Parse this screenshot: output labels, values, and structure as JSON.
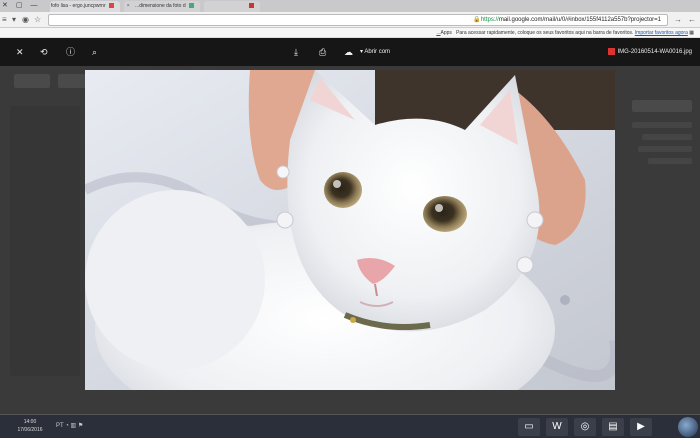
{
  "browser": {
    "tabs": [
      {
        "label": "fofo lisa - ergo.juncpwrnr"
      },
      {
        "label": "dimensione da foto d..."
      },
      {
        "label": ""
      }
    ],
    "window_controls": [
      "✕",
      "▢",
      "—"
    ],
    "url_scheme": "https://",
    "url_rest": "mail.google.com/mail/u/0/#inbox/155f4112a557b?projector=1",
    "bookmarks_text": "Para acessar rapidamente, coloque os seus favoritos aqui na barra de favoritos.",
    "bookmarks_link": "Importar favoritos agora...",
    "apps_label": "Apps"
  },
  "viewer": {
    "filename": "IMG-20160514-WA0016.jpg",
    "open_with": "Abrir com",
    "icons": [
      "close-icon",
      "back-icon",
      "info-icon",
      "zoom-icon",
      "download-icon",
      "print-icon",
      "drive-icon"
    ]
  },
  "taskbar": {
    "time": "14:00",
    "date": "17/06/2016",
    "tray_text": "PT"
  },
  "colors": {
    "viewer_bg": "#161616",
    "https_green": "#0a8f3b",
    "taskbar": "#2a2f3a"
  }
}
